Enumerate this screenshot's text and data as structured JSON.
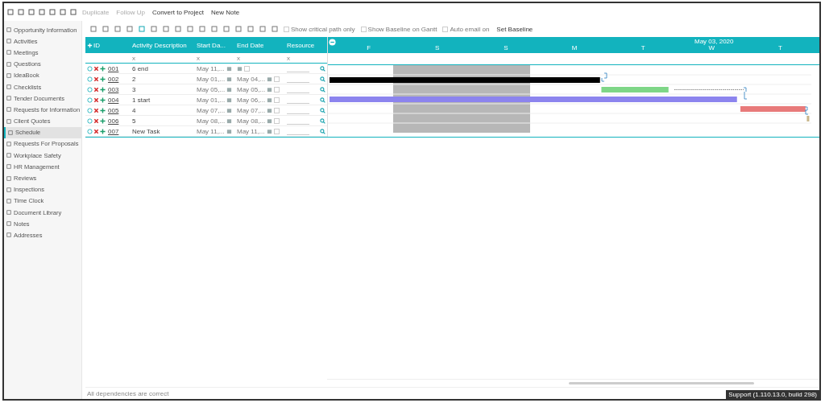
{
  "top_toolbar": {
    "actions": [
      {
        "label": "Duplicate",
        "disabled": true
      },
      {
        "label": "Follow Up",
        "disabled": true
      },
      {
        "label": "Convert to Project",
        "disabled": false
      },
      {
        "label": "New Note",
        "disabled": false
      }
    ]
  },
  "sidebar": {
    "items": [
      {
        "label": "Opportunity Information",
        "selected": false
      },
      {
        "label": "Activities",
        "selected": false
      },
      {
        "label": "Meetings",
        "selected": false
      },
      {
        "label": "Questions",
        "selected": false
      },
      {
        "label": "IdeaBook",
        "selected": false
      },
      {
        "label": "Checklists",
        "selected": false
      },
      {
        "label": "Tender Documents",
        "selected": false
      },
      {
        "label": "Requests for Information",
        "selected": false
      },
      {
        "label": "Client Quotes",
        "selected": false
      },
      {
        "label": "Schedule",
        "selected": true
      },
      {
        "label": "Requests For Proposals",
        "selected": false
      },
      {
        "label": "Workplace Safety",
        "selected": false
      },
      {
        "label": "HR Management",
        "selected": false
      },
      {
        "label": "Reviews",
        "selected": false
      },
      {
        "label": "Inspections",
        "selected": false
      },
      {
        "label": "Time Clock",
        "selected": false
      },
      {
        "label": "Document Library",
        "selected": false
      },
      {
        "label": "Notes",
        "selected": false
      },
      {
        "label": "Addresses",
        "selected": false
      }
    ]
  },
  "grid_toolbar": {
    "options": [
      {
        "label": "Show critical path only",
        "checked": false
      },
      {
        "label": "Show Baseline on Gantt",
        "checked": false
      },
      {
        "label": "Auto email on",
        "checked": false
      }
    ],
    "set_baseline": "Set Baseline"
  },
  "table": {
    "columns": [
      "ID",
      "Activity Description",
      "Start Da...",
      "End Date",
      "Resource"
    ],
    "filter_marks": [
      "x",
      "x",
      "x",
      "x"
    ],
    "rows": [
      {
        "id": "001",
        "description": "6 end",
        "start": "May 11,...",
        "end": "",
        "checked": false
      },
      {
        "id": "002",
        "description": "2",
        "start": "May 01,...",
        "end": "May 04,...",
        "checked": false,
        "color": "#000000"
      },
      {
        "id": "003",
        "description": "3",
        "start": "May 05,...",
        "end": "May 05,...",
        "checked": false,
        "color": "#7ed687"
      },
      {
        "id": "004",
        "description": "1 start",
        "start": "May 01,...",
        "end": "May 06,...",
        "checked": false,
        "color": "#8c84ee"
      },
      {
        "id": "005",
        "description": "4",
        "start": "May 07,...",
        "end": "May 07,...",
        "checked": false,
        "color": "#e87a7a"
      },
      {
        "id": "006",
        "description": "5",
        "start": "May 08,...",
        "end": "May 08,...",
        "checked": false,
        "color": "#c8b68a"
      },
      {
        "id": "007",
        "description": "New Task",
        "start": "May 11,...",
        "end": "May 11,...",
        "checked": false
      }
    ]
  },
  "gantt": {
    "week_label": "May 03, 2020",
    "days": [
      "F",
      "S",
      "S",
      "M",
      "T",
      "W",
      "T"
    ]
  },
  "status_bar": {
    "message": "All dependencies are correct",
    "version": "Support (1.110.13.0, build 298)"
  }
}
